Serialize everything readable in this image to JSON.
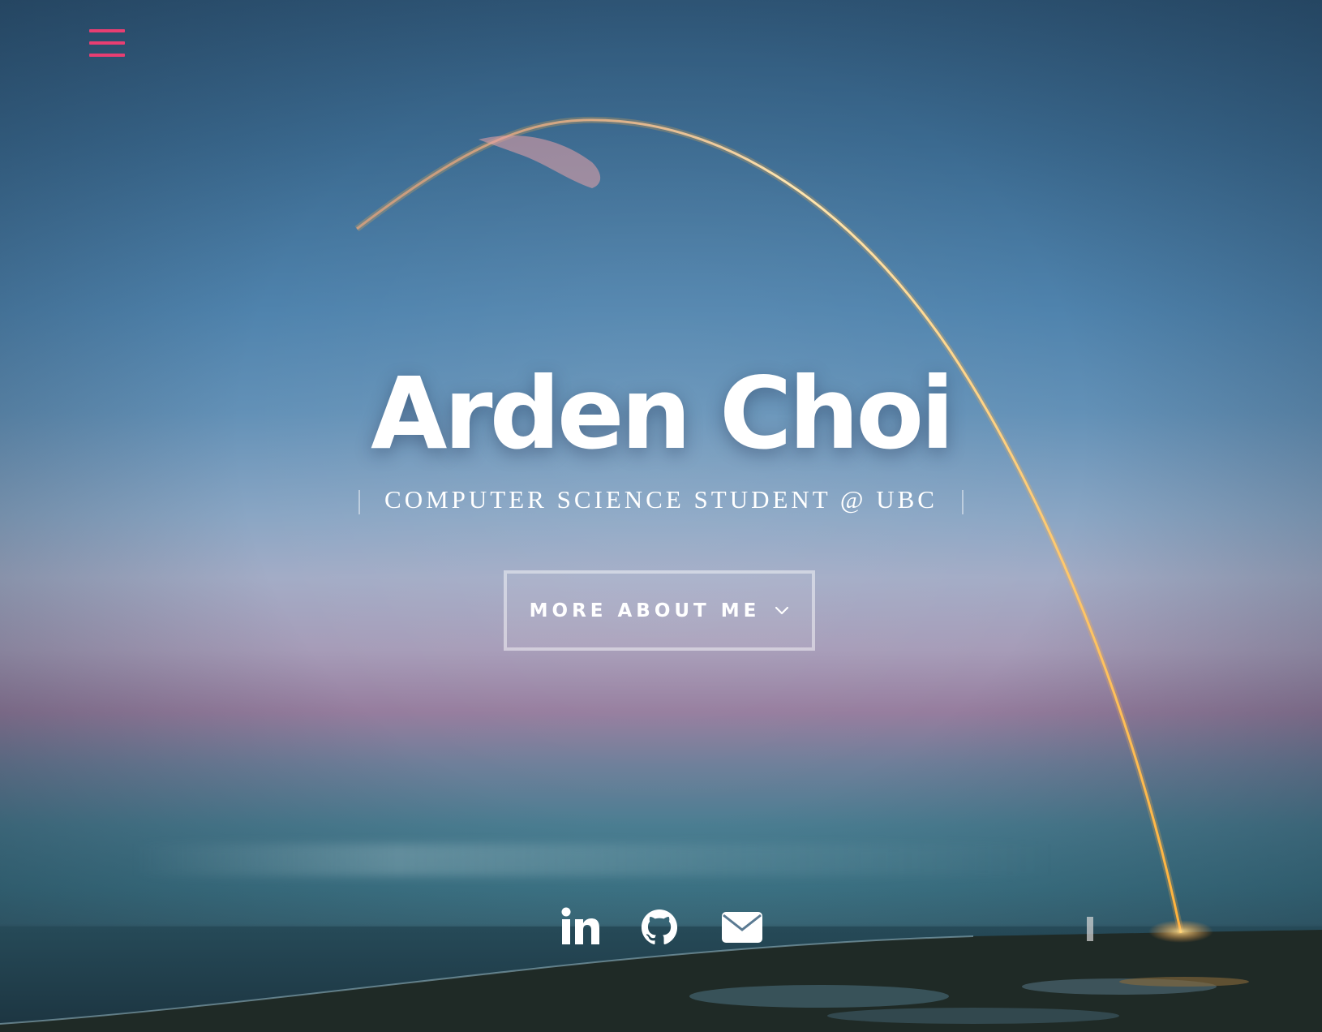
{
  "header": {
    "menu_icon": "hamburger-menu-icon",
    "menu_color": "#e83e72"
  },
  "hero": {
    "title": "Arden Choi",
    "subtitle": "COMPUTER SCIENCE STUDENT @ UBC",
    "cta_label": "MORE ABOUT ME",
    "cta_icon": "chevron-down-icon"
  },
  "social": {
    "links": [
      {
        "icon": "linkedin-icon"
      },
      {
        "icon": "github-icon"
      },
      {
        "icon": "mail-icon"
      }
    ]
  },
  "colors": {
    "accent": "#e83e72",
    "text": "#ffffff",
    "trail": "#ffb347"
  }
}
